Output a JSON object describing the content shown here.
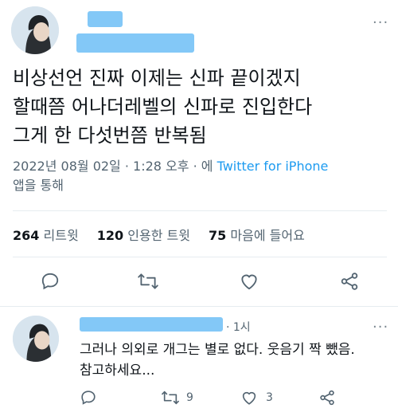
{
  "tweet": {
    "text_lines": [
      "비상선언 진짜 이제는 신파 끝이겠지",
      "할때쯤 어나더레벨의 신파로 진입한다",
      "그게 한 다섯번쯤 반복됨"
    ],
    "timestamp": "2022년 08월 02일 · 1:28 오후 · 에",
    "via": "Twitter for iPhone",
    "via_suffix": "앱을 통해",
    "stats": {
      "retweets_count": "264",
      "retweets_label": "리트윗",
      "quotes_count": "120",
      "quotes_label": "인용한 트윗",
      "likes_count": "75",
      "likes_label": "마음에 들어요"
    },
    "actions": [
      "reply-icon",
      "retweet-icon",
      "like-icon",
      "share-icon"
    ]
  },
  "reply": {
    "time": "· 1시",
    "text_lines": [
      "그러나 의외로 개그는 별로 없다. 웃음기 짝 뺐음.",
      "참고하세요..."
    ],
    "retweet_count": "9",
    "like_count": "3"
  },
  "colors": {
    "accent": "#1d9bf0",
    "secondary_text": "#536471"
  }
}
